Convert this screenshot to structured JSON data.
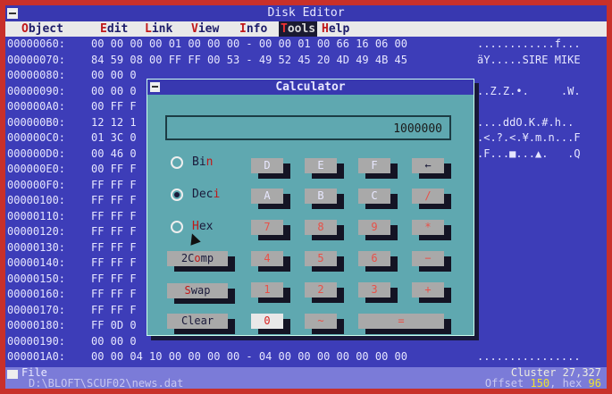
{
  "window": {
    "title": "Disk Editor"
  },
  "menu": [
    {
      "hot": "O",
      "rest": "bject"
    },
    {
      "hot": "E",
      "rest": "dit"
    },
    {
      "hot": "L",
      "rest": "ink"
    },
    {
      "hot": "V",
      "rest": "iew"
    },
    {
      "hot": "I",
      "rest": "nfo"
    },
    {
      "hot": "T",
      "rest": "ools"
    },
    {
      "hot": "H",
      "rest": "elp"
    }
  ],
  "hex_rows": [
    {
      "offset": "00000060:",
      "bytes": "00 00 00 00 01 00 00 00 - 00 00 01 00 66 16 06 00",
      "ascii": "............f..."
    },
    {
      "offset": "00000070:",
      "bytes": "84 59 08 00 FF FF 00 53 - 49 52 45 20 4D 49 4B 45",
      "ascii": "äY.....SIRE MIKE"
    },
    {
      "offset": "00000080:",
      "bytes": "00 00 0",
      "ascii": ""
    },
    {
      "offset": "00000090:",
      "bytes": "00 00 0",
      "ascii": "..Z.Z.•.     .W."
    },
    {
      "offset": "000000A0:",
      "bytes": "00 FF F",
      "ascii": ""
    },
    {
      "offset": "000000B0:",
      "bytes": "12 12 1",
      "ascii": "....ddO.K.#.h.."
    },
    {
      "offset": "000000C0:",
      "bytes": "01 3C 0",
      "ascii": ".<.?.<.¥.m.n...F"
    },
    {
      "offset": "000000D0:",
      "bytes": "00 46 0",
      "ascii": ".F...■...▲.   .Q"
    },
    {
      "offset": "000000E0:",
      "bytes": "00 FF F",
      "ascii": ""
    },
    {
      "offset": "000000F0:",
      "bytes": "FF FF F",
      "ascii": ""
    },
    {
      "offset": "00000100:",
      "bytes": "FF FF F",
      "ascii": ""
    },
    {
      "offset": "00000110:",
      "bytes": "FF FF F",
      "ascii": ""
    },
    {
      "offset": "00000120:",
      "bytes": "FF FF F",
      "ascii": ""
    },
    {
      "offset": "00000130:",
      "bytes": "FF FF F",
      "ascii": ""
    },
    {
      "offset": "00000140:",
      "bytes": "FF FF F",
      "ascii": ""
    },
    {
      "offset": "00000150:",
      "bytes": "FF FF F",
      "ascii": ""
    },
    {
      "offset": "00000160:",
      "bytes": "FF FF F",
      "ascii": ""
    },
    {
      "offset": "00000170:",
      "bytes": "FF FF F",
      "ascii": ""
    },
    {
      "offset": "00000180:",
      "bytes": "FF 0D 0",
      "ascii": ""
    },
    {
      "offset": "00000190:",
      "bytes": "00 00 0",
      "ascii": ""
    },
    {
      "offset": "000001A0:",
      "bytes": "00 00 04 10 00 00 00 00 - 04 00 00 00 00 00 00 00",
      "ascii": "................"
    }
  ],
  "calculator": {
    "title": "Calculator",
    "display": "1000000",
    "modes": [
      {
        "hot": "",
        "pre": "Bi",
        "hk": "n",
        "selected": false
      },
      {
        "hot": "",
        "pre": "Dec",
        "hk": "i",
        "selected": true
      },
      {
        "hot": "H",
        "pre": "",
        "hk": "",
        "post": "ex",
        "selected": false
      }
    ],
    "func_buttons": {
      "twocomp_a": "2C",
      "twocomp_hk": "o",
      "twocomp_b": "mp",
      "swap_hk": "S",
      "swap_rest": "wap",
      "clear": "Clear"
    },
    "keys": {
      "d": "D",
      "e": "E",
      "f": "F",
      "back": "←",
      "a": "A",
      "b": "B",
      "c": "C",
      "div": "/",
      "k7": "7",
      "k8": "8",
      "k9": "9",
      "mul": "*",
      "k4": "4",
      "k5": "5",
      "k6": "6",
      "sub": "−",
      "k1": "1",
      "k2": "2",
      "k3": "3",
      "add": "+",
      "k0": "0",
      "neg": "~",
      "eq": "="
    }
  },
  "status": {
    "label": "File",
    "path": "D:\\BLOFT\\SCUF02\\news.dat",
    "cluster": "Cluster 27,327",
    "offset_prefix": "Offset",
    "offset_val": "150",
    "hex_prefix": "hex",
    "hex_val": "96"
  }
}
